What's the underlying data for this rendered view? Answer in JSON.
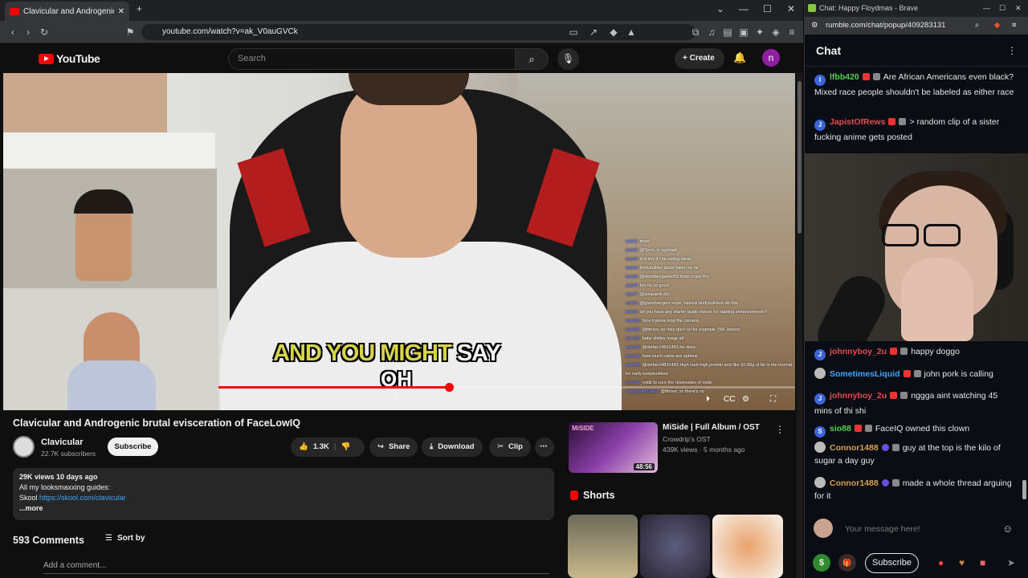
{
  "browser_left": {
    "tab_title": "Clavicular and Androgenic b",
    "new_tab": "+",
    "url": "youtube.com/watch?v=ak_V0auGVCk",
    "controls": [
      "⌄",
      "—",
      "☐",
      "✕"
    ]
  },
  "youtube": {
    "logo_text": "YouTube",
    "search_placeholder": "Search",
    "create_label": "Create",
    "avatar_letter": "n",
    "video": {
      "subtitle_yellow": "AND YOU MIGHT",
      "subtitle_white": "SAY",
      "subtitle_line2": "OH",
      "progress_fraction": 0.4,
      "overlay_chat": [
        {
          "name": "user1",
          "text": "lmao"
        },
        {
          "name": "user2",
          "text": "@Term_H sgomad"
        },
        {
          "name": "user3",
          "text": "is it tiny if i be eating steak"
        },
        {
          "name": "user4",
          "text": "bodybuilder spots taken so far"
        },
        {
          "name": "user5",
          "text": "@deprtlarygamer52 thats crazy tho"
        },
        {
          "name": "user6",
          "text": "bro its so good"
        },
        {
          "name": "user7",
          "text": "@sonpamk ofc"
        },
        {
          "name": "user8",
          "text": "@greedvergent nope, natural bodybuilders do this"
        },
        {
          "name": "user9",
          "text": "do you have any starter guide videos for starting enhancements?"
        },
        {
          "name": "user10",
          "text": "bros tryinna mog the camera"
        },
        {
          "name": "user11",
          "text": "@fitnxec no they don't lol for example TNF doesnt"
        },
        {
          "name": "user12",
          "text": "baby shitley moge all"
        },
        {
          "name": "user13",
          "text": "@stefan14831483 he does"
        },
        {
          "name": "user14",
          "text": "how much carbs are optimal"
        },
        {
          "name": "user15",
          "text": "@stefan14831483 High carb high protein and like 50-60g of fat is the normal for natty bodybuilders"
        },
        {
          "name": "user16",
          "text": "roids to cure the downsides of roids"
        },
        {
          "name": "stefan14831483",
          "text": "@fitnxec yo there's no"
        }
      ]
    },
    "title": "Clavicular and Androgenic brutal evisceration of FaceLowIQ",
    "channel": {
      "name": "Clavicular",
      "subs": "22.7K subscribers",
      "subscribe": "Subscribe"
    },
    "actions": {
      "likes": "1.3K",
      "share": "Share",
      "download": "Download",
      "clip": "Clip",
      "more": "⋯"
    },
    "description": {
      "meta": "29K views  10 days ago",
      "line1": "All my looksmaxxing guides:",
      "skool_label": "Skool",
      "skool_link": "https://skool.com/clavicular",
      "more": "...more"
    },
    "comments": {
      "count": "593 Comments",
      "sort": "Sort by",
      "add": "Add a comment..."
    },
    "recommended": {
      "title": "MiSide | Full Album / OST",
      "channel": "Crowdrip's OST",
      "meta": "439K views · 5 months ago",
      "duration": "48:56",
      "thumb_label": "MiSIDE"
    },
    "shorts_label": "Shorts"
  },
  "browser_right": {
    "tab_title": "Chat: Happy Floydmas - Brave",
    "url": "rumble.com/chat/popup/409283131",
    "chat_title": "Chat",
    "messages_top": [
      {
        "initial": "I",
        "user": "lfbb420",
        "color": "#4fd14f",
        "text": "Are African Americans even black? Mixed race people shouldn't be labeled as either race"
      },
      {
        "initial": "J",
        "user": "JapistOfRews",
        "color": "#e14d4d",
        "text": "> random clip of a sister fucking anime gets posted"
      }
    ],
    "messages_bottom": [
      {
        "initial": "J",
        "user": "johnnyboy_2u",
        "color": "#e14d4d",
        "text": "happy doggo"
      },
      {
        "initial": "",
        "user": "SometimesLiquid",
        "color": "#3ea6ff",
        "text": "john pork is calling"
      },
      {
        "initial": "J",
        "user": "johnnyboy_2u",
        "color": "#e14d4d",
        "text": "nggga aint watching 45 mins of thi shi"
      },
      {
        "initial": "S",
        "user": "sio88",
        "color": "#4fd14f",
        "text": "FaceIQ owned this clown"
      },
      {
        "initial": "",
        "user": "Connor1488",
        "color": "#d9a050",
        "text": "guy at the top is the kilo of sugar a day guy"
      },
      {
        "initial": "",
        "user": "Connor1488",
        "color": "#d9a050",
        "text": "made a whole thread arguing for it"
      }
    ],
    "input_placeholder": "Your message here!",
    "subscribe": "Subscribe",
    "money": "$"
  }
}
